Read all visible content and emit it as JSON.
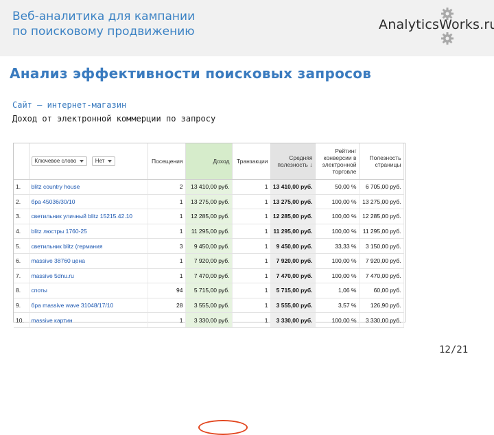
{
  "header": {
    "title_line1": "Веб-аналитика для кампании",
    "title_line2": "по поисковому продвижению",
    "logo_text": "AnalyticsWorks.ru"
  },
  "slide": {
    "title": "Анализ эффективности поисковых запросов",
    "subtitle1": "Сайт – интернет-магазин",
    "subtitle2": "Доход от электронной коммерции по запросу",
    "page": "12/21"
  },
  "table": {
    "controls": {
      "dimension": "Ключевое слово",
      "secondary": "Нет"
    },
    "headers": {
      "visits": "Посещения",
      "revenue": "Доход",
      "transactions": "Транзакции",
      "avg_value": "Средняя полезность",
      "sort_indicator": "↓",
      "rank": "Рейтинг конверсии в электронной торговле",
      "usefulness": "Полезность страницы"
    },
    "rows": [
      {
        "n": "1.",
        "keyword": "blitz country house",
        "visits": "2",
        "revenue": "13 410,00 руб.",
        "transactions": "1",
        "avg": "13 410,00 руб.",
        "rate": "50,00 %",
        "value": "6 705,00 руб."
      },
      {
        "n": "2.",
        "keyword": "бра 45036/30/10",
        "visits": "1",
        "revenue": "13 275,00 руб.",
        "transactions": "1",
        "avg": "13 275,00 руб.",
        "rate": "100,00 %",
        "value": "13 275,00 руб."
      },
      {
        "n": "3.",
        "keyword": "светильник уличный blitz 15215.42.10",
        "visits": "1",
        "revenue": "12 285,00 руб.",
        "transactions": "1",
        "avg": "12 285,00 руб.",
        "rate": "100,00 %",
        "value": "12 285,00 руб."
      },
      {
        "n": "4.",
        "keyword": "blitz люстры 1760-25",
        "visits": "1",
        "revenue": "11 295,00 руб.",
        "transactions": "1",
        "avg": "11 295,00 руб.",
        "rate": "100,00 %",
        "value": "11 295,00 руб."
      },
      {
        "n": "5.",
        "keyword": "светильник blitz (германия",
        "visits": "3",
        "revenue": "9 450,00 руб.",
        "transactions": "1",
        "avg": "9 450,00 руб.",
        "rate": "33,33 %",
        "value": "3 150,00 руб."
      },
      {
        "n": "6.",
        "keyword": "massive 38760 цена",
        "visits": "1",
        "revenue": "7 920,00 руб.",
        "transactions": "1",
        "avg": "7 920,00 руб.",
        "rate": "100,00 %",
        "value": "7 920,00 руб."
      },
      {
        "n": "7.",
        "keyword": "massive 5dnu.ru",
        "visits": "1",
        "revenue": "7 470,00 руб.",
        "transactions": "1",
        "avg": "7 470,00 руб.",
        "rate": "100,00 %",
        "value": "7 470,00 руб."
      },
      {
        "n": "8.",
        "keyword": "споты",
        "visits": "94",
        "revenue": "5 715,00 руб.",
        "transactions": "1",
        "avg": "5 715,00 руб.",
        "rate": "1,06 %",
        "value": "60,00 руб."
      },
      {
        "n": "9.",
        "keyword": "бра massive wave 31048/17/10",
        "visits": "28",
        "revenue": "3 555,00 руб.",
        "transactions": "1",
        "avg": "3 555,00 руб.",
        "rate": "3,57 %",
        "value": "126,90 руб."
      },
      {
        "n": "10.",
        "keyword": "massive картин",
        "visits": "1",
        "revenue": "3 330,00 руб.",
        "transactions": "1",
        "avg": "3 330,00 руб.",
        "rate": "100,00 %",
        "value": "3 330,00 руб."
      }
    ]
  },
  "colors": {
    "accent": "#3a7bbf",
    "highlight_circle": "#e2451d",
    "revenue_column": "#e6f3df"
  },
  "icons": [
    "gear-icon"
  ]
}
